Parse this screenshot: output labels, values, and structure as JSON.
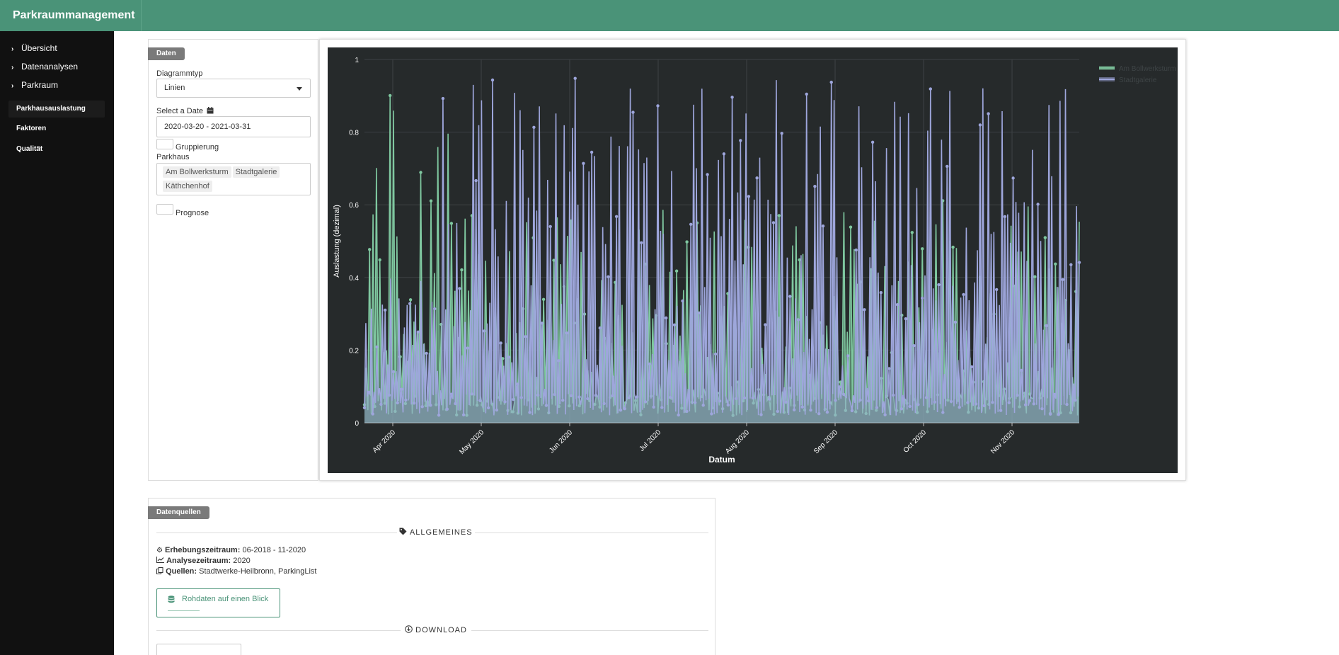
{
  "header": {
    "title": "Parkraummanagement"
  },
  "sidebar": {
    "items": [
      {
        "label": "Übersicht"
      },
      {
        "label": "Datenanalysen"
      },
      {
        "label": "Parkraum"
      }
    ],
    "subitems": [
      {
        "label": "Parkhausauslastung",
        "active": true
      },
      {
        "label": "Faktoren",
        "active": false
      },
      {
        "label": "Qualität",
        "active": false
      }
    ]
  },
  "controls": {
    "panel_tag": "Daten",
    "diagramtype_label": "Diagrammtyp",
    "diagramtype_value": "Linien",
    "date_label": "Select a Date",
    "date_value": "2020-03-20 - 2021-03-31",
    "group_label": "Gruppierung",
    "parkhaus_label": "Parkhaus",
    "parkhaus_tags": [
      "Am Bollwerksturm",
      "Stadtgalerie",
      "Käthchenhof"
    ],
    "prognose_label": "Prognose"
  },
  "chart_data": {
    "type": "area",
    "title": "",
    "xlabel": "Datum",
    "ylabel": "Auslastung (dezimal)",
    "ylim": [
      0,
      1
    ],
    "yticks": [
      "0",
      "0.2",
      "0.4",
      "0.6",
      "0.8",
      "1"
    ],
    "xticks": [
      "Apr 2020",
      "May 2020",
      "Jun 2020",
      "Jul 2020",
      "Aug 2020",
      "Sep 2020",
      "Oct 2020",
      "Nov 2020"
    ],
    "grid": true,
    "legend_position": "top-right",
    "series": [
      {
        "name": "Am Bollwerksturm",
        "color": "#7fc8a0"
      },
      {
        "name": "Stadtgalerie",
        "color": "#9ea6dc"
      }
    ]
  },
  "sources": {
    "panel_tag": "Datenquellen",
    "section_general": "ALLGEMEINES",
    "survey_label": "Erhebungszeitraum:",
    "survey_value": "06-2018 - 11-2020",
    "analysis_label": "Analysezeitraum:",
    "analysis_value": "2020",
    "sources_label": "Quellen:",
    "sources_value": "Stadtwerke-Heilbronn, ParkingList",
    "rawdata_button": "Rohdaten auf einen Blick",
    "section_download": "DOWNLOAD"
  }
}
